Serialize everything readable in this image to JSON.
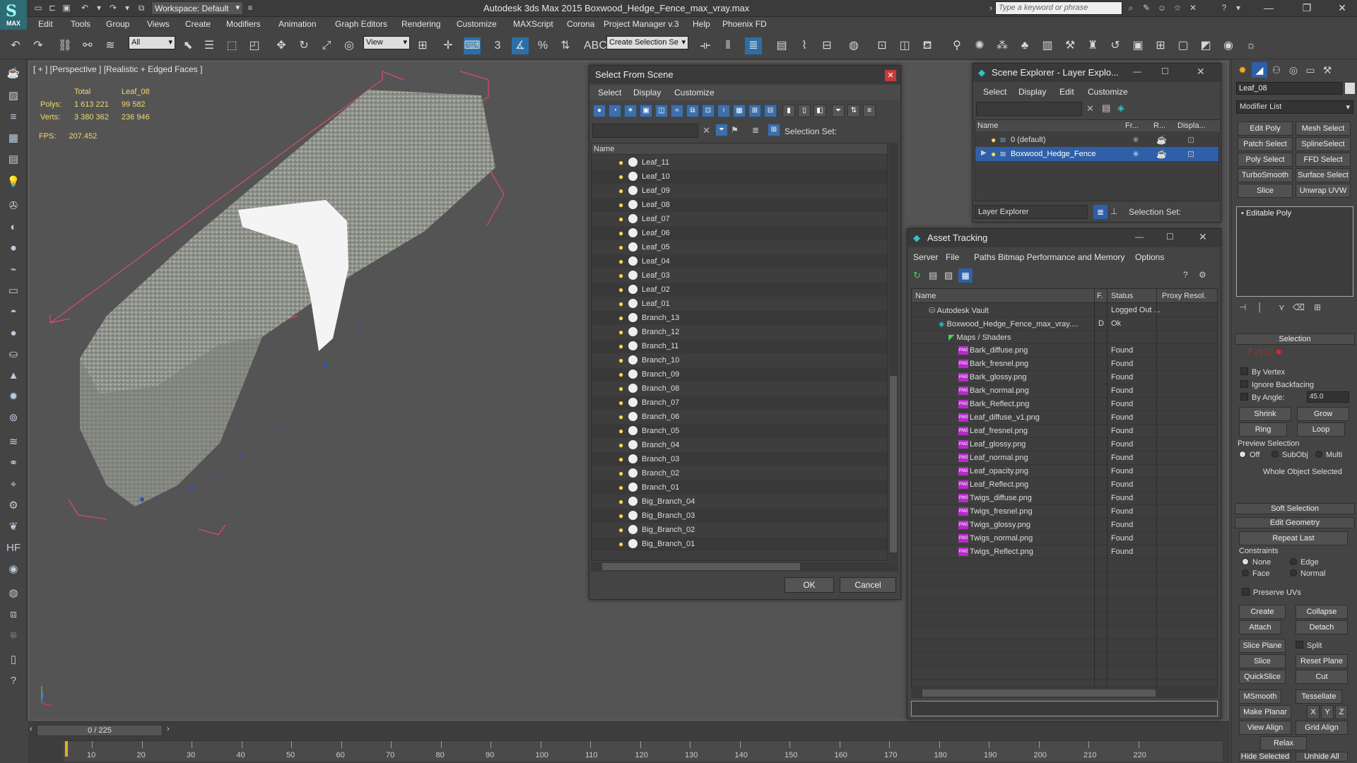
{
  "titlebar": {
    "workspace": "Workspace: Default",
    "title": "Autodesk 3ds Max  2015     Boxwood_Hedge_Fence_max_vray.max",
    "search_placeholder": "Type a keyword or phrase",
    "logo_text": "MAX"
  },
  "menu": [
    "Edit",
    "Tools",
    "Group",
    "Views",
    "Create",
    "Modifiers",
    "Animation",
    "Graph Editors",
    "Rendering",
    "Customize",
    "MAXScript",
    "Corona",
    "Project Manager v.3",
    "Help",
    "Phoenix FD"
  ],
  "toolbar": {
    "filter": "All",
    "ref_coord": "View",
    "selection_set": "Create Selection Se"
  },
  "viewport": {
    "label": "[ + ] [Perspective ] [Realistic + Edged Faces ]",
    "stats": {
      "h_total": "Total",
      "h_obj": "Leaf_08",
      "polys_label": "Polys:",
      "polys_total": "1 613 221",
      "polys_obj": "99 582",
      "verts_label": "Verts:",
      "verts_total": "3 380 362",
      "verts_obj": "236 946"
    },
    "fps_label": "FPS:",
    "fps_value": "207.452"
  },
  "timeline": {
    "frame": "0 / 225",
    "ticks": [
      "10",
      "20",
      "30",
      "40",
      "50",
      "60",
      "70",
      "80",
      "90",
      "100",
      "110",
      "120",
      "130",
      "140",
      "150",
      "160",
      "170",
      "180",
      "190",
      "200",
      "210",
      "220"
    ]
  },
  "select_from_scene": {
    "title": "Select From Scene",
    "menus": [
      "Select",
      "Display",
      "Customize"
    ],
    "selection_set_label": "Selection Set:",
    "col_name": "Name",
    "items": [
      "Leaf_11",
      "Leaf_10",
      "Leaf_09",
      "Leaf_08",
      "Leaf_07",
      "Leaf_06",
      "Leaf_05",
      "Leaf_04",
      "Leaf_03",
      "Leaf_02",
      "Leaf_01",
      "Branch_13",
      "Branch_12",
      "Branch_11",
      "Branch_10",
      "Branch_09",
      "Branch_08",
      "Branch_07",
      "Branch_06",
      "Branch_05",
      "Branch_04",
      "Branch_03",
      "Branch_02",
      "Branch_01",
      "Big_Branch_04",
      "Big_Branch_03",
      "Big_Branch_02",
      "Big_Branch_01"
    ],
    "ok": "OK",
    "cancel": "Cancel"
  },
  "scene_explorer": {
    "title": "Scene Explorer - Layer Explo...",
    "menus": [
      "Select",
      "Display",
      "Edit",
      "Customize"
    ],
    "cols": [
      "Name",
      "Fr...",
      "R...",
      "Displa..."
    ],
    "layers": [
      "0 (default)",
      "Boxwood_Hedge_Fence"
    ],
    "footer_dropdown": "Layer Explorer",
    "selection_set_label": "Selection Set:"
  },
  "asset_tracking": {
    "title": "Asset Tracking",
    "menus": [
      "Server",
      "File",
      "Paths",
      "Bitmap Performance and Memory",
      "Options"
    ],
    "cols": [
      "Name",
      "F.",
      "Status",
      "Proxy Resol."
    ],
    "vault": {
      "name": "Autodesk Vault",
      "status": "Logged Out ..."
    },
    "file": {
      "name": "Boxwood_Hedge_Fence_max_vray....",
      "flag": "D",
      "status": "Ok"
    },
    "group": "Maps / Shaders",
    "maps": [
      "Bark_diffuse.png",
      "Bark_fresnel.png",
      "Bark_glossy.png",
      "Bark_normal.png",
      "Bark_Reflect.png",
      "Leaf_diffuse_v1.png",
      "Leaf_fresnel.png",
      "Leaf_glossy.png",
      "Leaf_normal.png",
      "Leaf_opacity.png",
      "Leaf_Reflect.png",
      "Twigs_diffuse.png",
      "Twigs_fresnel.png",
      "Twigs_glossy.png",
      "Twigs_normal.png",
      "Twigs_Reflect.png"
    ],
    "found": "Found",
    "png_badge": "PNG"
  },
  "command_panel": {
    "object_name": "Leaf_08",
    "modifier_list": "Modifier List",
    "mod_buttons": [
      "Edit Poly",
      "Mesh Select",
      "Patch Select",
      "SplineSelect",
      "Poly Select",
      "FFD Select",
      "TurboSmooth",
      "Surface Select",
      "Slice",
      "Unwrap UVW"
    ],
    "stack_item": "Editable Poly",
    "selection": "Selection",
    "by_vertex": "By Vertex",
    "ignore_backfacing": "Ignore Backfacing",
    "by_angle": "By Angle:",
    "angle": "45.0",
    "shrink": "Shrink",
    "grow": "Grow",
    "ring": "Ring",
    "loop": "Loop",
    "preview_selection": "Preview Selection",
    "off": "Off",
    "subobj": "SubObj",
    "multi": "Multi",
    "whole_object": "Whole Object Selected",
    "soft_selection": "Soft Selection",
    "edit_geometry": "Edit Geometry",
    "repeat_last": "Repeat Last",
    "constraints": "Constraints",
    "none": "None",
    "edge": "Edge",
    "face": "Face",
    "normal": "Normal",
    "preserve_uvs": "Preserve UVs",
    "create": "Create",
    "collapse": "Collapse",
    "attach": "Attach",
    "detach": "Detach",
    "slice_plane": "Slice Plane",
    "split": "Split",
    "slice": "Slice",
    "reset_plane": "Reset Plane",
    "quickslice": "QuickSlice",
    "cut": "Cut",
    "msmooth": "MSmooth",
    "tessellate": "Tessellate",
    "make_planar": "Make Planar",
    "x": "X",
    "y": "Y",
    "z": "Z",
    "view_align": "View Align",
    "grid_align": "Grid Align",
    "relax": "Relax",
    "hide_selected": "Hide Selected",
    "unhide_all": "Unhide All"
  },
  "colors": {
    "accent": "#3e6fa8",
    "selected_row": "#2f5fa8",
    "stats": "#f2d96b",
    "bbox": "#d24b6e"
  }
}
